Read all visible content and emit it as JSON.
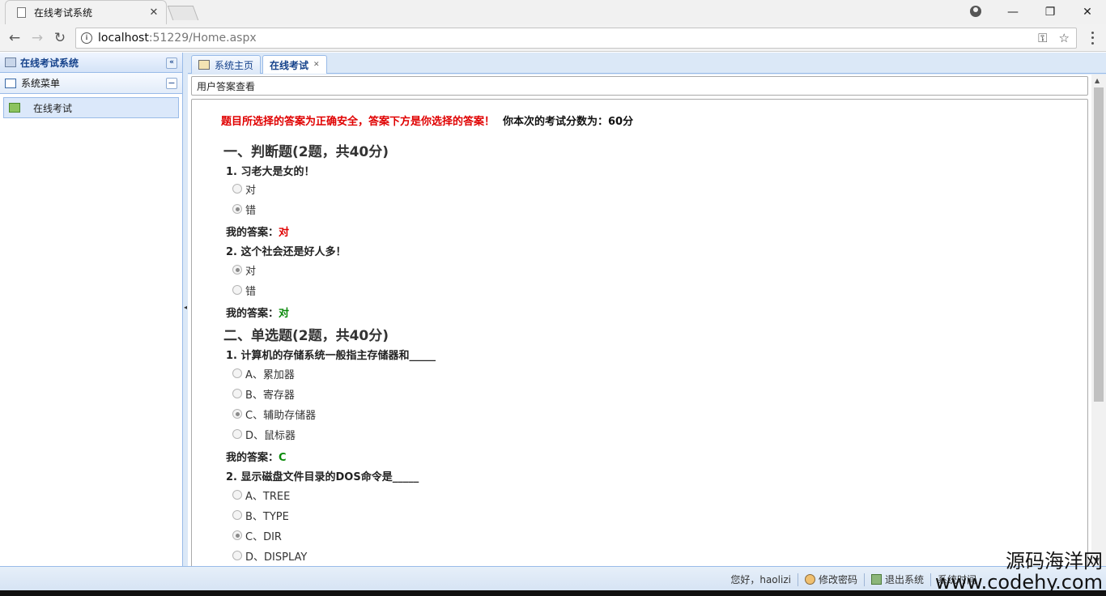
{
  "browser": {
    "tab_title": "在线考试系统",
    "tab_close": "✕",
    "url_host": "localhost",
    "url_rest": ":51229/Home.aspx"
  },
  "west": {
    "title": "在线考试系统",
    "menu_title": "系统菜单",
    "items": [
      {
        "label": "在线考试"
      }
    ]
  },
  "tabs": [
    {
      "label": "系统主页"
    },
    {
      "label": "在线考试"
    }
  ],
  "content": {
    "subtitle": "用户答案查看",
    "notice_red": "题目所选择的答案为正确安全，答案下方是你选择的答案！",
    "notice_score": "你本次的考试分数为：60分",
    "my_answer_label": "我的答案：",
    "sections": [
      {
        "title": "一、判断题(2题，共40分)",
        "questions": [
          {
            "title": "1. 习老大是女的！",
            "options": [
              "对",
              "错"
            ],
            "checked": 1,
            "my_answer": "对",
            "answer_color": "red"
          },
          {
            "title": "2. 这个社会还是好人多！",
            "options": [
              "对",
              "错"
            ],
            "checked": 0,
            "my_answer": "对",
            "answer_color": "green"
          }
        ]
      },
      {
        "title": "二、单选题(2题，共40分)",
        "questions": [
          {
            "title": "1. 计算机的存储系统一般指主存储器和_____",
            "options": [
              "A、累加器",
              "B、寄存器",
              "C、辅助存储器",
              "D、鼠标器"
            ],
            "checked": 2,
            "my_answer": "C",
            "answer_color": "green"
          },
          {
            "title": "2. 显示磁盘文件目录的DOS命令是_____",
            "options": [
              "A、TREE",
              "B、TYPE",
              "C、DIR",
              "D、DISPLAY"
            ],
            "checked": 2
          }
        ]
      }
    ]
  },
  "status": {
    "greeting": "您好，haolizi",
    "change_password": "修改密码",
    "logout": "退出系统",
    "time_label": "系统时间"
  },
  "watermark": {
    "line1": "源码海洋网",
    "line2": "www.codehy.com"
  },
  "colors": {
    "accent": "#15428b",
    "panel_border": "#99bbe8",
    "wrong": "#e00000",
    "right": "#0a8a0a"
  }
}
